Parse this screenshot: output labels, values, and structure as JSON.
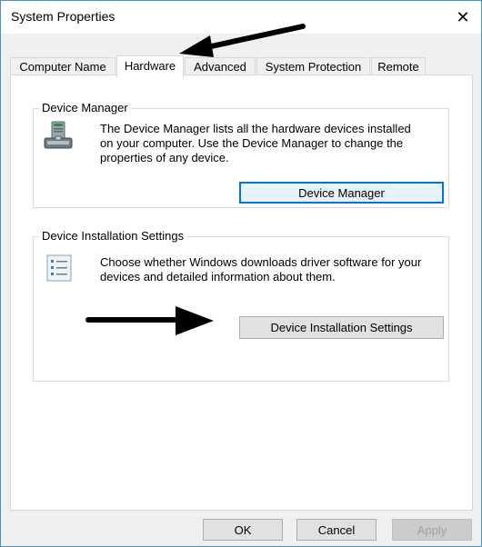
{
  "window": {
    "title": "System Properties",
    "close_glyph": "✕"
  },
  "tabs": [
    {
      "label": "Computer Name",
      "active": false
    },
    {
      "label": "Hardware",
      "active": true
    },
    {
      "label": "Advanced",
      "active": false
    },
    {
      "label": "System Protection",
      "active": false
    },
    {
      "label": "Remote",
      "active": false
    }
  ],
  "device_manager": {
    "legend": "Device Manager",
    "description_lines": [
      "The Device Manager lists all the hardware devices installed",
      "on your computer. Use the Device Manager to change the",
      "properties of any device."
    ],
    "button_label": "Device Manager",
    "icon": "device-manager-icon"
  },
  "device_installation": {
    "legend": "Device Installation Settings",
    "description_lines": [
      "Choose whether Windows downloads driver software for your",
      "devices and detailed information about them."
    ],
    "button_label": "Device Installation Settings",
    "icon": "checklist-icon"
  },
  "footer": {
    "ok_label": "OK",
    "cancel_label": "Cancel",
    "apply_label": "Apply"
  },
  "annotations": {
    "arrow_color": "#000000"
  },
  "colors": {
    "accent": "#0078d7",
    "window_border": "#4a90c8"
  }
}
